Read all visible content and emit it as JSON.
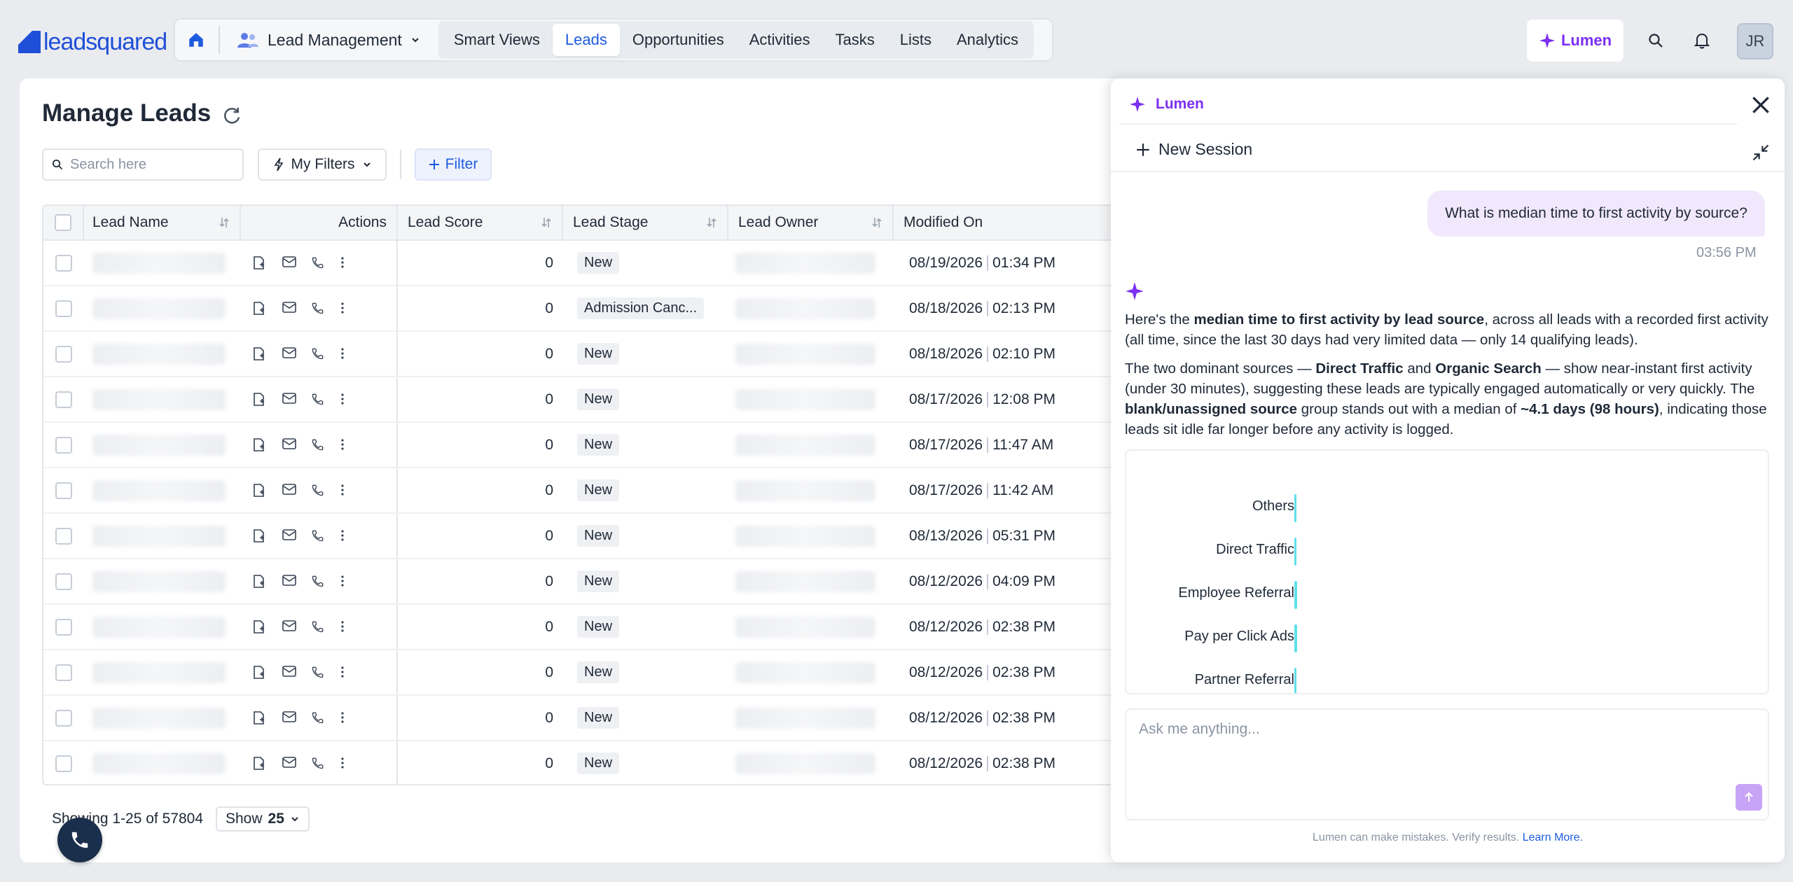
{
  "brand": {
    "name": "leadsquared",
    "color": "#1f4fd8"
  },
  "nav": {
    "module": "Lead Management",
    "tabs": [
      {
        "label": "Smart Views",
        "active": false
      },
      {
        "label": "Leads",
        "active": true
      },
      {
        "label": "Opportunities",
        "active": false
      },
      {
        "label": "Activities",
        "active": false
      },
      {
        "label": "Tasks",
        "active": false
      },
      {
        "label": "Lists",
        "active": false
      },
      {
        "label": "Analytics",
        "active": false
      }
    ],
    "lumen_label": "Lumen",
    "avatar_initials": "JR"
  },
  "page": {
    "title": "Manage Leads",
    "search_placeholder": "Search here",
    "my_filters_label": "My Filters",
    "filter_label": "Filter"
  },
  "table": {
    "columns": {
      "name": "Lead Name",
      "actions": "Actions",
      "score": "Lead Score",
      "stage": "Lead Stage",
      "owner": "Lead Owner",
      "modified": "Modified On"
    },
    "rows": [
      {
        "score": "0",
        "stage": "New",
        "date": "08/19/2026",
        "time": "01:34 PM"
      },
      {
        "score": "0",
        "stage": "Admission Canc...",
        "date": "08/18/2026",
        "time": "02:13 PM"
      },
      {
        "score": "0",
        "stage": "New",
        "date": "08/18/2026",
        "time": "02:10 PM"
      },
      {
        "score": "0",
        "stage": "New",
        "date": "08/17/2026",
        "time": "12:08 PM"
      },
      {
        "score": "0",
        "stage": "New",
        "date": "08/17/2026",
        "time": "11:47 AM"
      },
      {
        "score": "0",
        "stage": "New",
        "date": "08/17/2026",
        "time": "11:42 AM"
      },
      {
        "score": "0",
        "stage": "New",
        "date": "08/13/2026",
        "time": "05:31 PM"
      },
      {
        "score": "0",
        "stage": "New",
        "date": "08/12/2026",
        "time": "04:09 PM"
      },
      {
        "score": "0",
        "stage": "New",
        "date": "08/12/2026",
        "time": "02:38 PM"
      },
      {
        "score": "0",
        "stage": "New",
        "date": "08/12/2026",
        "time": "02:38 PM"
      },
      {
        "score": "0",
        "stage": "New",
        "date": "08/12/2026",
        "time": "02:38 PM"
      },
      {
        "score": "0",
        "stage": "New",
        "date": "08/12/2026",
        "time": "02:38 PM"
      }
    ],
    "footer": {
      "showing": "Showing 1-25 of 57804",
      "show_label": "Show",
      "page_size": "25"
    }
  },
  "lumen_panel": {
    "tab_label": "Lumen",
    "new_session": "New Session",
    "user_message": "What is median time to first activity by source?",
    "message_time": "03:56 PM",
    "ai_paragraph_1": {
      "pre": "Here's the ",
      "bold": "median time to first activity by lead source",
      "post": ", across all leads with a recorded first activity (all time, since the last 30 days had very limited data — only 14 qualifying leads)."
    },
    "ai_paragraph_2": {
      "pre": "The two dominant sources — ",
      "bold1": "Direct Traffic",
      "mid1": " and ",
      "bold2": "Organic Search",
      "mid2": " — show near-instant first activity (under 30 minutes), suggesting these leads are typically engaged automatically or very quickly. The ",
      "bold3": "blank/unassigned source",
      "mid3": " group stands out with a median of ",
      "bold4": "~4.1 days (98 hours)",
      "post": ", indicating those leads sit idle far longer before any activity is logged."
    },
    "input_placeholder": "Ask me anything...",
    "disclaimer": "Lumen can make mistakes. Verify results.",
    "learn_more": "Learn More.",
    "accent_color": "#7b2ff2"
  },
  "chart_data": {
    "type": "bar",
    "orientation": "horizontal",
    "categories": [
      "Others",
      "Direct Traffic",
      "Employee Referral",
      "Pay per Click Ads",
      "Partner Referral"
    ],
    "values": [
      0.2,
      0.2,
      0.3,
      0.3,
      0.2
    ],
    "bar_color": "#5fe0ea"
  }
}
